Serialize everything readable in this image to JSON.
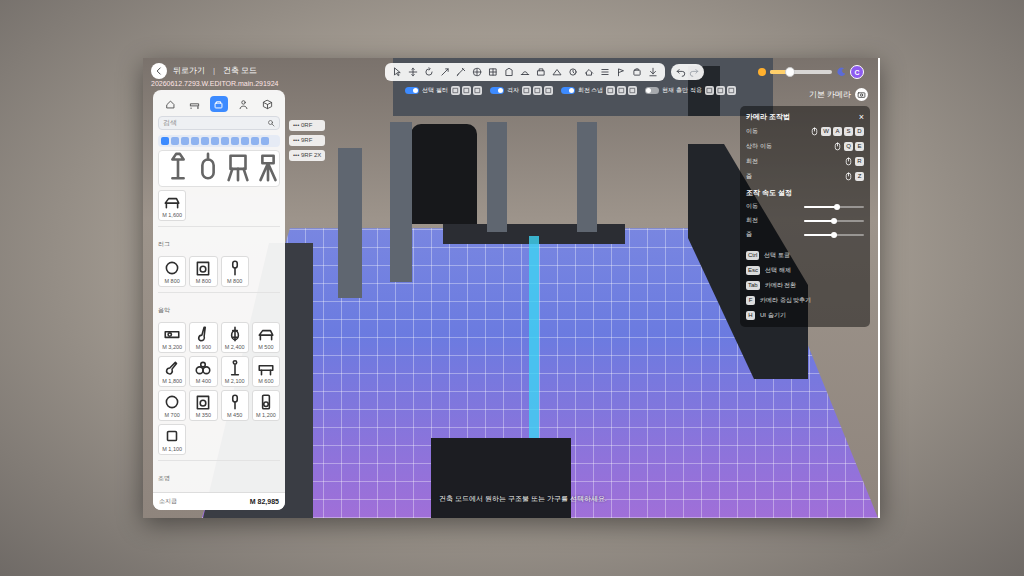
{
  "header": {
    "back_label": "뒤로가기",
    "separator": "|",
    "mode": "건축 모드",
    "build": "20260612.7293.W.EDITOR.main.291924"
  },
  "toolbar": {
    "tools": [
      {
        "selected": false
      },
      {
        "selected": false
      },
      {
        "selected": false
      },
      {
        "selected": false
      },
      {
        "selected": false
      },
      {
        "selected": false
      },
      {
        "selected": false
      },
      {
        "selected": false
      },
      {
        "selected": false
      },
      {
        "selected": false
      },
      {
        "selected": false
      },
      {
        "selected": false
      },
      {
        "selected": false
      },
      {
        "selected": false
      },
      {
        "selected": false
      },
      {
        "selected": false
      },
      {
        "selected": false
      }
    ]
  },
  "options": [
    {
      "label": "선택 필터",
      "on": true
    },
    {
      "label": "격자",
      "on": true
    },
    {
      "label": "회전 스냅",
      "on": true
    },
    {
      "label": "현재 층만 적용",
      "on": false
    }
  ],
  "time_slider": {
    "level": 0.32
  },
  "profile": {
    "initial": "C"
  },
  "camera": {
    "label": "기본 카메라"
  },
  "controls": {
    "title": "카메라 조작법",
    "close": "×",
    "moves": [
      {
        "label": "이동",
        "keys": [
          "W",
          "A",
          "S",
          "D"
        ]
      },
      {
        "label": "상하 이동",
        "keys": [
          "Q",
          "E"
        ]
      },
      {
        "label": "회전",
        "keys": [
          "R"
        ]
      },
      {
        "label": "줌",
        "keys": [
          "Z"
        ]
      }
    ],
    "speed_title": "조작 속도 설정",
    "speeds": [
      {
        "label": "이동",
        "level": 0.55
      },
      {
        "label": "회전",
        "level": 0.5
      },
      {
        "label": "줌",
        "level": 0.5
      }
    ],
    "shortcuts": [
      {
        "label": "선택 토글",
        "key": "Ctrl"
      },
      {
        "label": "선택 해제",
        "key": "Esc"
      },
      {
        "label": "카메라 전환",
        "key": "Tab"
      },
      {
        "label": "카메라 중심 맞추기",
        "key": "F"
      },
      {
        "label": "UI 숨기기",
        "key": "H"
      }
    ]
  },
  "side_chips": [
    "••• 0RF",
    "••• 9RF",
    "••• 9RF 2X"
  ],
  "catalog": {
    "tabs": [
      {
        "selected": false
      },
      {
        "selected": false
      },
      {
        "selected": true
      },
      {
        "selected": false
      },
      {
        "selected": false
      }
    ],
    "search": {
      "placeholder": "검색"
    },
    "categories": [
      {
        "selected": true
      },
      {
        "selected": false
      },
      {
        "selected": false
      },
      {
        "selected": false
      },
      {
        "selected": false
      },
      {
        "selected": false
      },
      {
        "selected": false
      },
      {
        "selected": false
      },
      {
        "selected": false
      },
      {
        "selected": false
      },
      {
        "selected": false
      }
    ],
    "sections": [
      {
        "title": "",
        "items": [
          {
            "price": "M 1,600"
          }
        ]
      },
      {
        "title": "러그",
        "items": [
          {
            "price": "M 800"
          },
          {
            "price": "M 800"
          },
          {
            "price": "M 800"
          }
        ]
      },
      {
        "title": "음악",
        "items": [
          {
            "price": "M 3,200"
          },
          {
            "price": "M 900"
          },
          {
            "price": "M 2,400"
          },
          {
            "price": "M 500"
          },
          {
            "price": "M 1,800"
          },
          {
            "price": "M 400"
          },
          {
            "price": "M 2,100"
          },
          {
            "price": "M 600"
          },
          {
            "price": "M 700"
          },
          {
            "price": "M 350"
          },
          {
            "price": "M 450"
          },
          {
            "price": "M 1,200"
          },
          {
            "price": "M 1,100"
          }
        ]
      },
      {
        "title": "조명",
        "items": []
      }
    ],
    "wallet": {
      "label": "소지금",
      "amount": "M 82,985"
    }
  },
  "hint": "건축 모드에서 원하는 구조물 또는 가구를 선택하세요."
}
